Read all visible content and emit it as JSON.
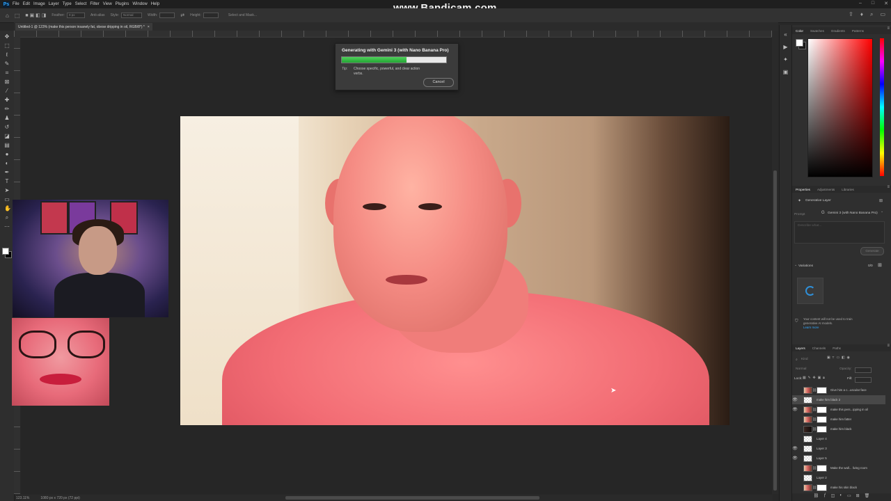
{
  "app": {
    "name": "Ps",
    "menu": [
      "File",
      "Edit",
      "Image",
      "Layer",
      "Type",
      "Select",
      "Filter",
      "View",
      "Plugins",
      "Window",
      "Help"
    ],
    "watermark": "www.Bandicam.com",
    "window_controls": [
      "–",
      "□",
      "✕"
    ]
  },
  "options_bar": {
    "feather_label": "Feather:",
    "feather_value": "0 px",
    "antialias_label": "Anti-alias",
    "style_label": "Style:",
    "style_value": "Normal",
    "width_label": "Width:",
    "height_label": "Height:",
    "select_mask_label": "Select and Mask..."
  },
  "document": {
    "tab_title": "Untitled-1 @ 123% (make this person insanely fat, obese dripping in oil, RGB/8*) *",
    "tab_close": "×",
    "zoom": "123.11%",
    "size_info": "1080 px x 720 px (72 ppi)"
  },
  "dialog": {
    "title": "Generating with Gemini 3 (with Nano Banana Pro)",
    "progress": 0.62,
    "tip_label": "Tip:",
    "tip_text": "Choose specific, powerful, and clear action verbs.",
    "cancel_label": "Cancel"
  },
  "panels": {
    "color_tabs": [
      "Color",
      "Swatches",
      "Gradients",
      "Patterns"
    ],
    "properties_tabs": [
      "Properties",
      "Adjustments",
      "Libraries"
    ],
    "properties": {
      "layer_type": "Generative Layer",
      "prompt_label": "Prompt",
      "model": "Gemini 3 (with Nano Banana Pro)",
      "prompt_placeholder": "Describe what...",
      "generate_label": "Generate",
      "variations_label": "Variations",
      "variations_count": "0/0",
      "privacy_note": "Your content will not be used to train generative AI models.",
      "learn_more": "Learn more"
    },
    "layers_tabs": [
      "Layers",
      "Channels",
      "Paths"
    ],
    "layers_controls": {
      "kind_label": "Kind",
      "blend_mode": "Normal",
      "opacity_label": "Opacity:",
      "lock_label": "Lock:",
      "fill_label": "Fill:"
    },
    "layers": [
      {
        "name": "Give him a c...uscular face",
        "visible": false,
        "selected": false,
        "thumb": "photo"
      },
      {
        "name": "make him black 2",
        "visible": true,
        "selected": true,
        "thumb": "check"
      },
      {
        "name": "make this pers...ipping in oil",
        "visible": true,
        "selected": false,
        "thumb": "photo"
      },
      {
        "name": "make him fatter",
        "visible": false,
        "selected": false,
        "thumb": "photo"
      },
      {
        "name": "make him black",
        "visible": false,
        "selected": false,
        "thumb": "dark"
      },
      {
        "name": "Layer 4",
        "visible": false,
        "selected": false,
        "thumb": "check"
      },
      {
        "name": "Layer 3",
        "visible": true,
        "selected": false,
        "thumb": "check"
      },
      {
        "name": "Layer 5",
        "visible": true,
        "selected": false,
        "thumb": "check"
      },
      {
        "name": "Make the wall... living room",
        "visible": false,
        "selected": false,
        "thumb": "photo"
      },
      {
        "name": "Layer 2",
        "visible": false,
        "selected": false,
        "thumb": "check"
      },
      {
        "name": "make his skin black",
        "visible": false,
        "selected": false,
        "thumb": "photo"
      }
    ],
    "layers_bottom_icons": [
      "link-icon",
      "fx-icon",
      "mask-icon",
      "adjustment-icon",
      "group-icon",
      "new-layer-icon",
      "trash-icon"
    ]
  },
  "colors": {
    "progress_green": "#2fb83e",
    "accent_blue": "#31a8ff"
  }
}
